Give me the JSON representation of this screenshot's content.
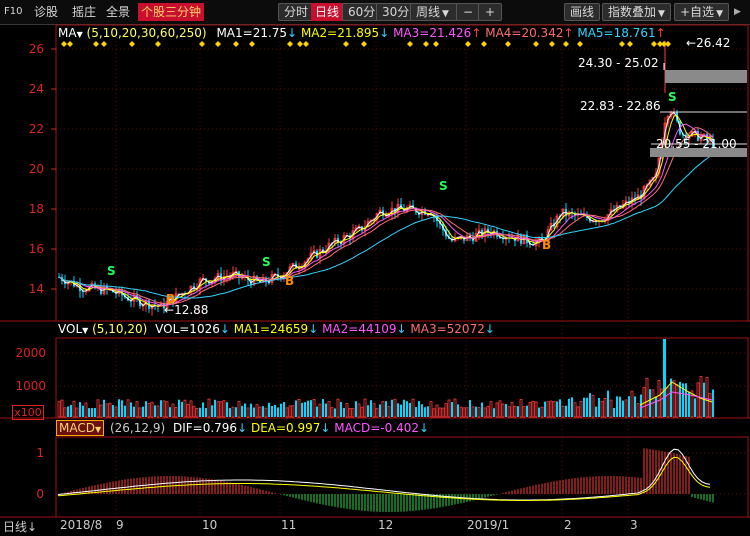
{
  "toolbar": {
    "f10": "F10",
    "diagnose": "诊股",
    "sync": "摇庄",
    "panorama": "全景",
    "min3": "个股三分钟",
    "intraday": "分时",
    "daily": "日线",
    "m60": "60分",
    "m30": "30分",
    "weekly": "周线",
    "minus": "−",
    "plus": "+",
    "line": "画线",
    "index_overlay": "指数叠加",
    "watchlist": "+自选"
  },
  "main_legend": {
    "name": "MA",
    "params": "(5,10,20,30,60,250)",
    "ma1": "MA1=21.75",
    "ma2": "MA2=21.895",
    "ma3": "MA3=21.426",
    "ma4": "MA4=20.342",
    "ma5": "MA5=18.761"
  },
  "vol_legend": {
    "name": "VOL",
    "params": "(5,10,20)",
    "vol": "VOL=1026",
    "ma1": "MA1=24659",
    "ma2": "MA2=44109",
    "ma3": "MA3=52072"
  },
  "macd_legend": {
    "name": "MACD",
    "params": "(26,12,9)",
    "dif": "DIF=0.796",
    "dea": "DEA=0.997",
    "macd": "MACD=-0.402"
  },
  "price_axis": [
    "26",
    "24",
    "22",
    "20",
    "18",
    "16",
    "14"
  ],
  "vol_axis": [
    "2000",
    "1000",
    "x100"
  ],
  "macd_axis": [
    "1",
    "0"
  ],
  "x_labels": [
    "2018/8",
    "9",
    "10",
    "11",
    "12",
    "2019/1",
    "2",
    "3"
  ],
  "period_switch": "日线",
  "annotations": {
    "high": "26.42",
    "low": "12.88",
    "box1": "24.30 - 25.02",
    "box2": "22.83 - 22.86",
    "box3": "20.55 - 21.00"
  },
  "signals": {
    "s": "S",
    "b": "B"
  },
  "colors": {
    "up": "#ff3b3b",
    "down": "#00d8ff",
    "ma1": "#ffffff",
    "ma2": "#ffff00",
    "ma3": "#ff55ff",
    "ma4": "#ff6e6e",
    "ma5": "#2fd6ff",
    "axis_red": "#dd2222"
  }
}
